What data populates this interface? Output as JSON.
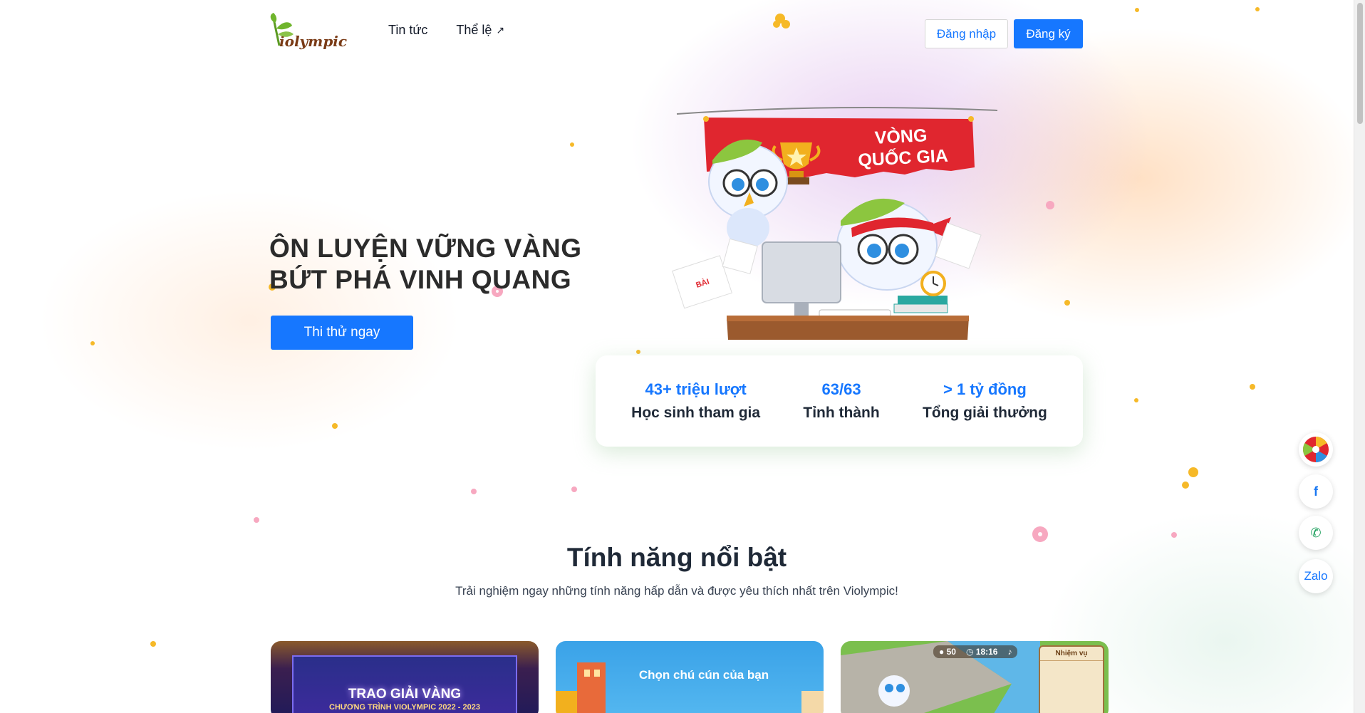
{
  "header": {
    "logo_text": "iolympic",
    "nav": [
      {
        "label": "Tin tức",
        "external": false
      },
      {
        "label": "Thể lệ",
        "external": true
      }
    ],
    "login_label": "Đăng nhập",
    "register_label": "Đăng ký"
  },
  "hero": {
    "title_line1": "ÔN LUYỆN VỮNG VÀNG",
    "title_line2": "BỨT PHÁ VINH QUANG",
    "cta_label": "Thi thử ngay",
    "banner_line1": "VÒNG",
    "banner_line2": "QUỐC GIA"
  },
  "stats": [
    {
      "value": "43+ triệu lượt",
      "label": "Học sinh tham gia"
    },
    {
      "value": "63/63",
      "label": "Tỉnh thành"
    },
    {
      "value": "> 1 tỷ đồng",
      "label": "Tổng giải thưởng"
    }
  ],
  "side_buttons": {
    "wheel_icon": "lucky-wheel-icon",
    "facebook_icon": "facebook-icon",
    "phone_icon": "phone-icon",
    "zalo_label": "Zalo"
  },
  "features": {
    "title": "Tính năng nổi bật",
    "subtitle": "Trải nghiệm ngay những tính năng hấp dẫn và được yêu thích nhất trên Violympic!",
    "cards": [
      {
        "title": "TRAO GIẢI VÀNG",
        "subtitle": "CHƯƠNG TRÌNH VIOLYMPIC 2022 - 2023"
      },
      {
        "title": "Chọn chú cún của bạn"
      },
      {
        "coins": "50",
        "time": "18:16",
        "panel_title": "Nhiệm vụ"
      }
    ]
  },
  "colors": {
    "primary": "#1677ff",
    "banner_red": "#e0262f",
    "desk_brown": "#9b5a2e"
  }
}
